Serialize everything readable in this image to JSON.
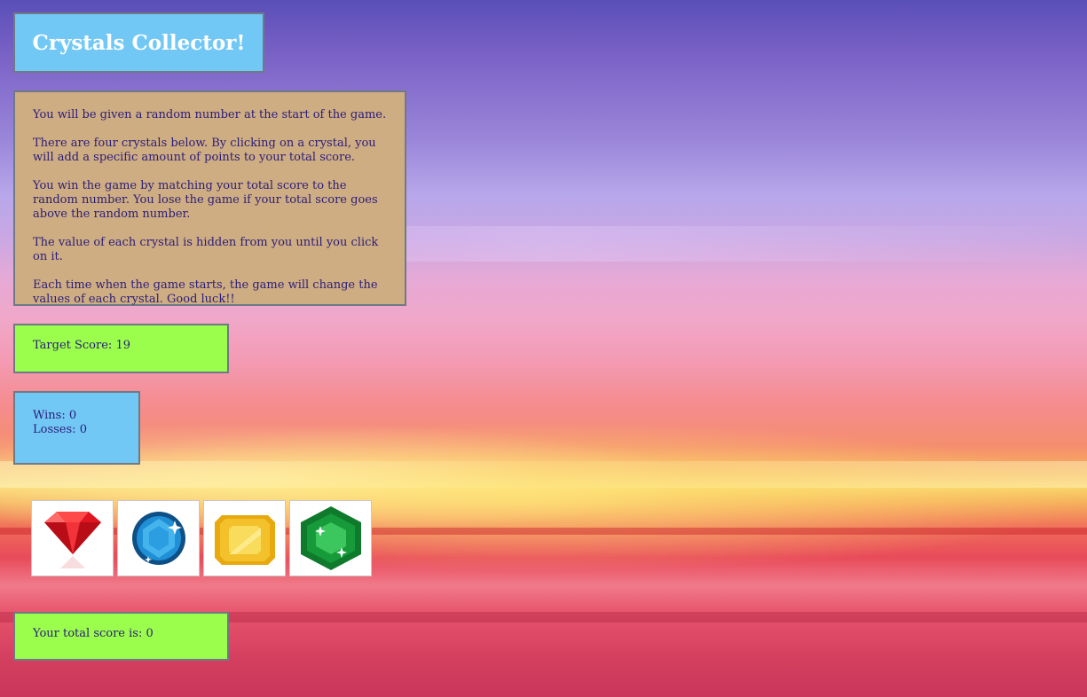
{
  "title": "Crystals Collector!",
  "instructions": [
    "You will be given a random number at the start of the game.",
    "There are four crystals below. By clicking on a crystal, you will add a specific amount of points to your total score.",
    "You win the game by matching your total score to the random number. You lose the game if your total score goes above the random number.",
    "The value of each crystal is hidden from you until you click on it.",
    "Each time when the game starts, the game will change the values of each crystal. Good luck!!"
  ],
  "target": {
    "label": "Target Score: ",
    "value": "19"
  },
  "record": {
    "wins_label": "Wins: ",
    "wins": "0",
    "losses_label": "Losses: ",
    "losses": "0"
  },
  "crystals": [
    {
      "icon": "red-diamond-icon",
      "color": "#e0151f"
    },
    {
      "icon": "blue-sapphire-icon",
      "color": "#1f8fd6"
    },
    {
      "icon": "yellow-topaz-icon",
      "color": "#f3c12c"
    },
    {
      "icon": "green-emerald-icon",
      "color": "#169a3a"
    }
  ],
  "total": {
    "label": "Your total score is: ",
    "value": "0"
  },
  "colors": {
    "title_bg": "#72c8f5",
    "instructions_bg": "#cfad82",
    "score_bg": "#9bfd4c",
    "text": "#2a1d7a"
  }
}
